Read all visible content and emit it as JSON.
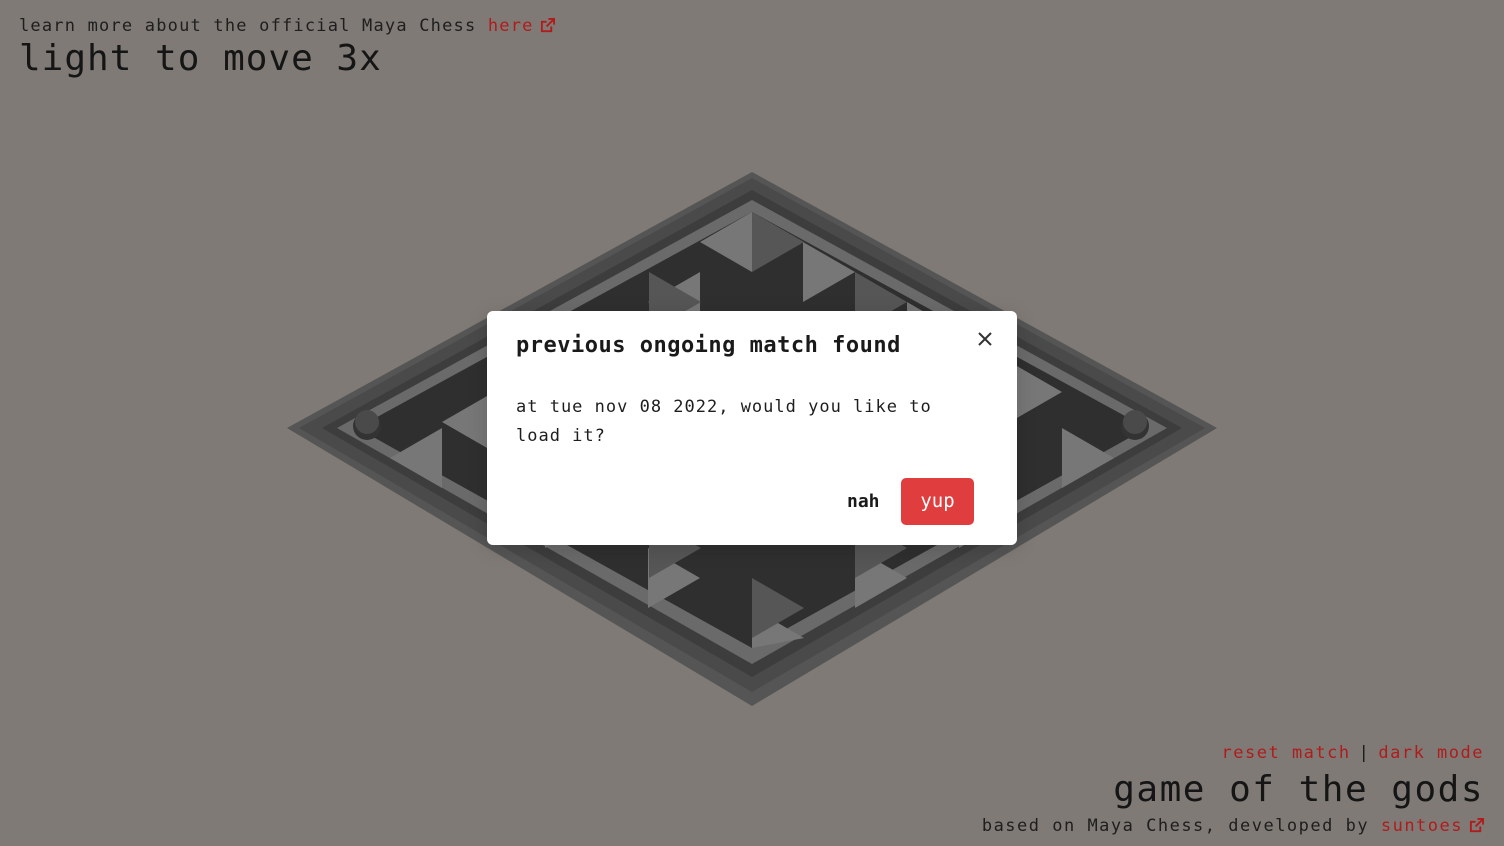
{
  "header": {
    "learn_prefix": "learn more about the official Maya Chess",
    "learn_link": "here",
    "turn_status": "light to move 3x"
  },
  "footer": {
    "reset_label": "reset match",
    "separator": "|",
    "dark_mode_label": "dark mode",
    "game_title": "game of the gods",
    "credit_prefix": "based on Maya Chess, developed by",
    "credit_link": "suntoes"
  },
  "dialog": {
    "title": "previous ongoing match found",
    "message": "at tue nov 08 2022, would you like to load it?",
    "cancel_label": "nah",
    "confirm_label": "yup"
  },
  "colors": {
    "background": "#7f7a75",
    "link": "#b01c1c",
    "confirm_button": "#e03e3e",
    "board_dark": "#3a3a3a",
    "board_light": "#707070"
  },
  "icons": {
    "external_link": "external-link-icon",
    "close": "close-icon"
  }
}
